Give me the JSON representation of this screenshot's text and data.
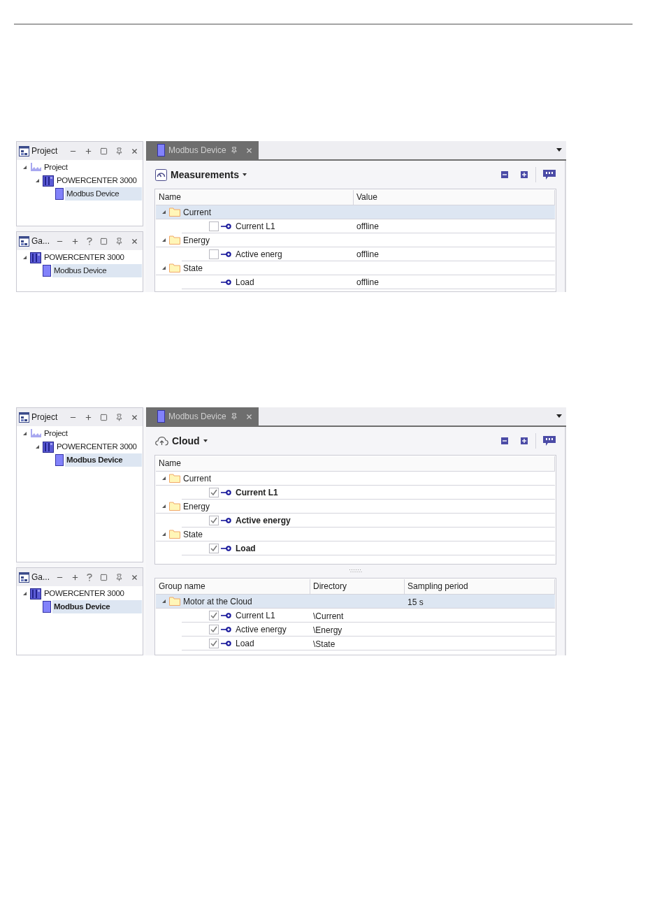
{
  "screenshots": [
    {
      "project_panel": {
        "title": "Project",
        "buttons": [
          {
            "kind": "minimize"
          },
          {
            "kind": "maximize"
          },
          {
            "kind": "restore"
          },
          {
            "kind": "pin"
          },
          {
            "kind": "close"
          }
        ],
        "tree": [
          {
            "label": "Project",
            "kind": "project",
            "expanded": true,
            "selected": false,
            "bold": false,
            "children": [
              {
                "label": "POWERCENTER 3000",
                "kind": "device",
                "expanded": true,
                "selected": false,
                "bold": false,
                "children": [
                  {
                    "label": "Modbus Device",
                    "kind": "module",
                    "selected": true,
                    "bold": false
                  }
                ]
              }
            ]
          }
        ]
      },
      "gateway_panel": {
        "title": "Ga...",
        "buttons": [
          {
            "kind": "minimize"
          },
          {
            "kind": "maximize"
          },
          {
            "kind": "help"
          },
          {
            "kind": "restore"
          },
          {
            "kind": "pin"
          },
          {
            "kind": "close"
          }
        ],
        "tree": [
          {
            "label": "POWERCENTER 3000",
            "kind": "device",
            "expanded": true,
            "selected": false,
            "bold": false,
            "children": [
              {
                "label": "Modbus Device",
                "kind": "module",
                "selected": true,
                "bold": false
              }
            ]
          }
        ]
      },
      "tab": {
        "label": "Modbus Device"
      },
      "view": {
        "title": "Measurements",
        "kind": "measurements"
      },
      "table": {
        "columns": [
          "Name",
          "Value"
        ],
        "rows": [
          {
            "kind": "group",
            "label": "Current",
            "expanded": true,
            "selected": true
          },
          {
            "kind": "item",
            "label": "Current L1",
            "checked": false,
            "bold": false,
            "selected": false,
            "value": "offline"
          },
          {
            "kind": "group",
            "label": "Energy",
            "expanded": true,
            "selected": false
          },
          {
            "kind": "item",
            "label": "Active energ",
            "checked": false,
            "bold": false,
            "selected": false,
            "value": "offline"
          },
          {
            "kind": "group",
            "label": "State",
            "expanded": true,
            "selected": false
          },
          {
            "kind": "item",
            "label": "Load",
            "bold": false,
            "selected": false,
            "value": "offline"
          }
        ]
      }
    },
    {
      "project_panel": {
        "title": "Project",
        "buttons": [
          {
            "kind": "minimize"
          },
          {
            "kind": "maximize"
          },
          {
            "kind": "restore"
          },
          {
            "kind": "pin"
          },
          {
            "kind": "close"
          }
        ],
        "tree": [
          {
            "label": "Project",
            "kind": "project",
            "expanded": true,
            "selected": false,
            "bold": false,
            "children": [
              {
                "label": "POWERCENTER 3000",
                "kind": "device",
                "expanded": true,
                "selected": false,
                "bold": false,
                "children": [
                  {
                    "label": "Modbus Device",
                    "kind": "module",
                    "selected": true,
                    "bold": true
                  }
                ]
              }
            ]
          }
        ]
      },
      "gateway_panel": {
        "title": "Ga...",
        "buttons": [
          {
            "kind": "minimize"
          },
          {
            "kind": "maximize"
          },
          {
            "kind": "help"
          },
          {
            "kind": "restore"
          },
          {
            "kind": "pin"
          },
          {
            "kind": "close"
          }
        ],
        "tree": [
          {
            "label": "POWERCENTER 3000",
            "kind": "device",
            "expanded": true,
            "selected": false,
            "bold": false,
            "children": [
              {
                "label": "Modbus Device",
                "kind": "module",
                "selected": true,
                "bold": true
              }
            ]
          }
        ]
      },
      "tab": {
        "label": "Modbus Device"
      },
      "view": {
        "title": "Cloud",
        "kind": "cloud"
      },
      "table": {
        "columns": [
          "Name"
        ],
        "rows": [
          {
            "kind": "group",
            "label": "Current",
            "expanded": true,
            "selected": false
          },
          {
            "kind": "item",
            "label": "Current L1",
            "checked": true,
            "bold": true,
            "selected": false
          },
          {
            "kind": "group",
            "label": "Energy",
            "expanded": true,
            "selected": false
          },
          {
            "kind": "item",
            "label": "Active energy",
            "checked": true,
            "bold": true,
            "selected": false
          },
          {
            "kind": "group",
            "label": "State",
            "expanded": true,
            "selected": false
          },
          {
            "kind": "item",
            "label": "Load",
            "checked": true,
            "bold": true,
            "selected": false
          }
        ]
      },
      "group_table": {
        "columns": [
          "Group name",
          "Directory",
          "Sampling period"
        ],
        "rows": [
          {
            "kind": "group",
            "label": "Motor at the Cloud",
            "expanded": true,
            "selected": true,
            "sampling_period": "15 s"
          },
          {
            "kind": "item",
            "label": "Current L1",
            "checked": true,
            "bold": false,
            "selected": false,
            "directory": "\\Current"
          },
          {
            "kind": "item",
            "label": "Active energy",
            "checked": true,
            "bold": false,
            "selected": false,
            "directory": "\\Energy"
          },
          {
            "kind": "item",
            "label": "Load",
            "checked": true,
            "bold": false,
            "selected": false,
            "directory": "\\State"
          }
        ]
      }
    }
  ]
}
